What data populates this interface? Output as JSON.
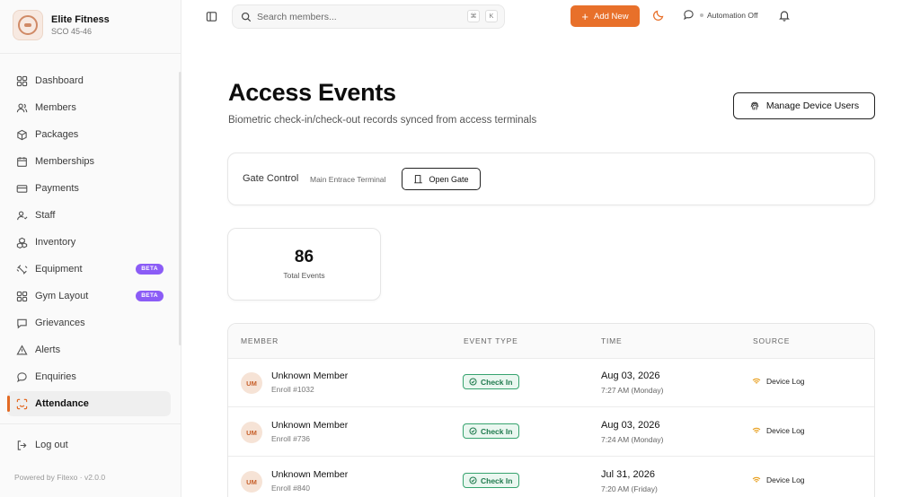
{
  "brand": {
    "name": "Elite Fitness",
    "sub": "SCO 45-46"
  },
  "sidebar": {
    "items": [
      {
        "label": "Dashboard",
        "icon": "dashboard-icon"
      },
      {
        "label": "Members",
        "icon": "users-icon"
      },
      {
        "label": "Packages",
        "icon": "package-icon"
      },
      {
        "label": "Memberships",
        "icon": "calendar-icon"
      },
      {
        "label": "Payments",
        "icon": "credit-card-icon"
      },
      {
        "label": "Staff",
        "icon": "staff-icon"
      },
      {
        "label": "Inventory",
        "icon": "boxes-icon"
      },
      {
        "label": "Equipment",
        "icon": "dumbbell-icon",
        "badge": "BETA"
      },
      {
        "label": "Gym Layout",
        "icon": "layout-icon",
        "badge": "BETA"
      },
      {
        "label": "Grievances",
        "icon": "message-icon"
      },
      {
        "label": "Alerts",
        "icon": "alert-icon"
      },
      {
        "label": "Enquiries",
        "icon": "chat-icon"
      },
      {
        "label": "Attendance",
        "icon": "scan-icon",
        "active": true
      }
    ],
    "logout": "Log out",
    "powered": "Powered by Fitexo · v2.0.0"
  },
  "topbar": {
    "search_placeholder": "Search members...",
    "kbd_cmd": "⌘",
    "kbd_k": "K",
    "add_new": "Add New",
    "automation": "Automation Off"
  },
  "main": {
    "title": "Access Events",
    "subtitle": "Biometric check-in/check-out records synced from access terminals",
    "manage_button": "Manage Device Users"
  },
  "gate": {
    "label": "Gate Control",
    "terminal": "Main Entrace Terminal",
    "open_button": "Open Gate"
  },
  "stats": {
    "value": "86",
    "label": "Total Events"
  },
  "table": {
    "headers": [
      "MEMBER",
      "EVENT TYPE",
      "TIME",
      "SOURCE"
    ],
    "rows": [
      {
        "initials": "UM",
        "name": "Unknown Member",
        "enroll": "Enroll #1032",
        "event": "Check In",
        "date": "Aug 03, 2026",
        "time": "7:27 AM (Monday)",
        "source": "Device Log"
      },
      {
        "initials": "UM",
        "name": "Unknown Member",
        "enroll": "Enroll #736",
        "event": "Check In",
        "date": "Aug 03, 2026",
        "time": "7:24 AM (Monday)",
        "source": "Device Log"
      },
      {
        "initials": "UM",
        "name": "Unknown Member",
        "enroll": "Enroll #840",
        "event": "Check In",
        "date": "Jul 31, 2026",
        "time": "7:20 AM (Friday)",
        "source": "Device Log"
      }
    ]
  },
  "colors": {
    "accent": "#e8702a",
    "beta": "#8b5cf6",
    "check_in": "#36a36e",
    "source_wifi": "#e8a020"
  }
}
